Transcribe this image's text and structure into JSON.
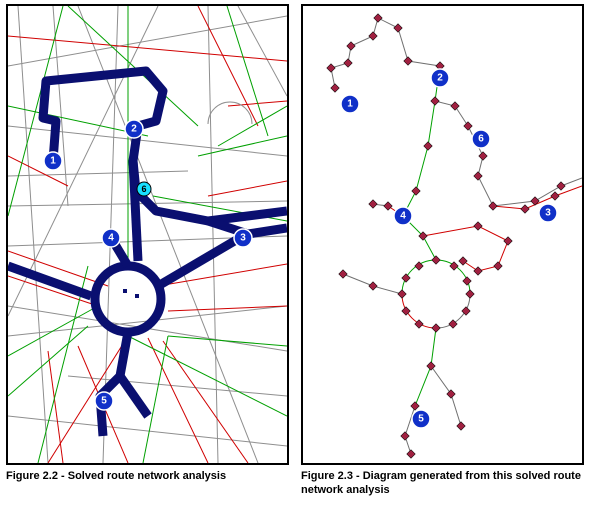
{
  "captions": {
    "left": "Figure 2.2 - Solved route network analysis",
    "right": "Figure 2.3 - Diagram generated from this solved route network analysis"
  },
  "stops_map": {
    "1": "1",
    "2": "2",
    "3": "3",
    "4": "4",
    "5": "5",
    "6": "6"
  },
  "stops_diagram": {
    "1": "1",
    "2": "2",
    "3": "3",
    "4": "4",
    "5": "5",
    "6": "6"
  }
}
